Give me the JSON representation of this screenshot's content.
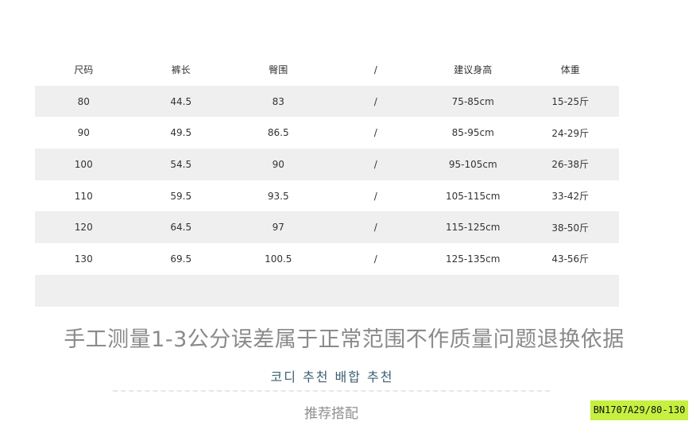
{
  "size_table": {
    "headers": [
      "尺码",
      "裤长",
      "臀围",
      "/",
      "建议身高",
      "体重"
    ],
    "rows": [
      [
        "80",
        "44.5",
        "83",
        "/",
        "75-85cm",
        "15-25斤"
      ],
      [
        "90",
        "49.5",
        "86.5",
        "/",
        "85-95cm",
        "24-29斤"
      ],
      [
        "100",
        "54.5",
        "90",
        "/",
        "95-105cm",
        "26-38斤"
      ],
      [
        "110",
        "59.5",
        "93.5",
        "/",
        "105-115cm",
        "33-42斤"
      ],
      [
        "120",
        "64.5",
        "97",
        "/",
        "115-125cm",
        "38-50斤"
      ],
      [
        "130",
        "69.5",
        "100.5",
        "/",
        "125-135cm",
        "43-56斤"
      ],
      [
        "",
        "",
        "",
        "",
        "",
        ""
      ]
    ]
  },
  "notice": "手工测量1-3公分误差属于正常范围不作质量问题退换依据",
  "korean_heading": "코디 추천 배합 추천",
  "recommend_label": "推荐搭配",
  "product_code": "BN1707A29/80-130"
}
